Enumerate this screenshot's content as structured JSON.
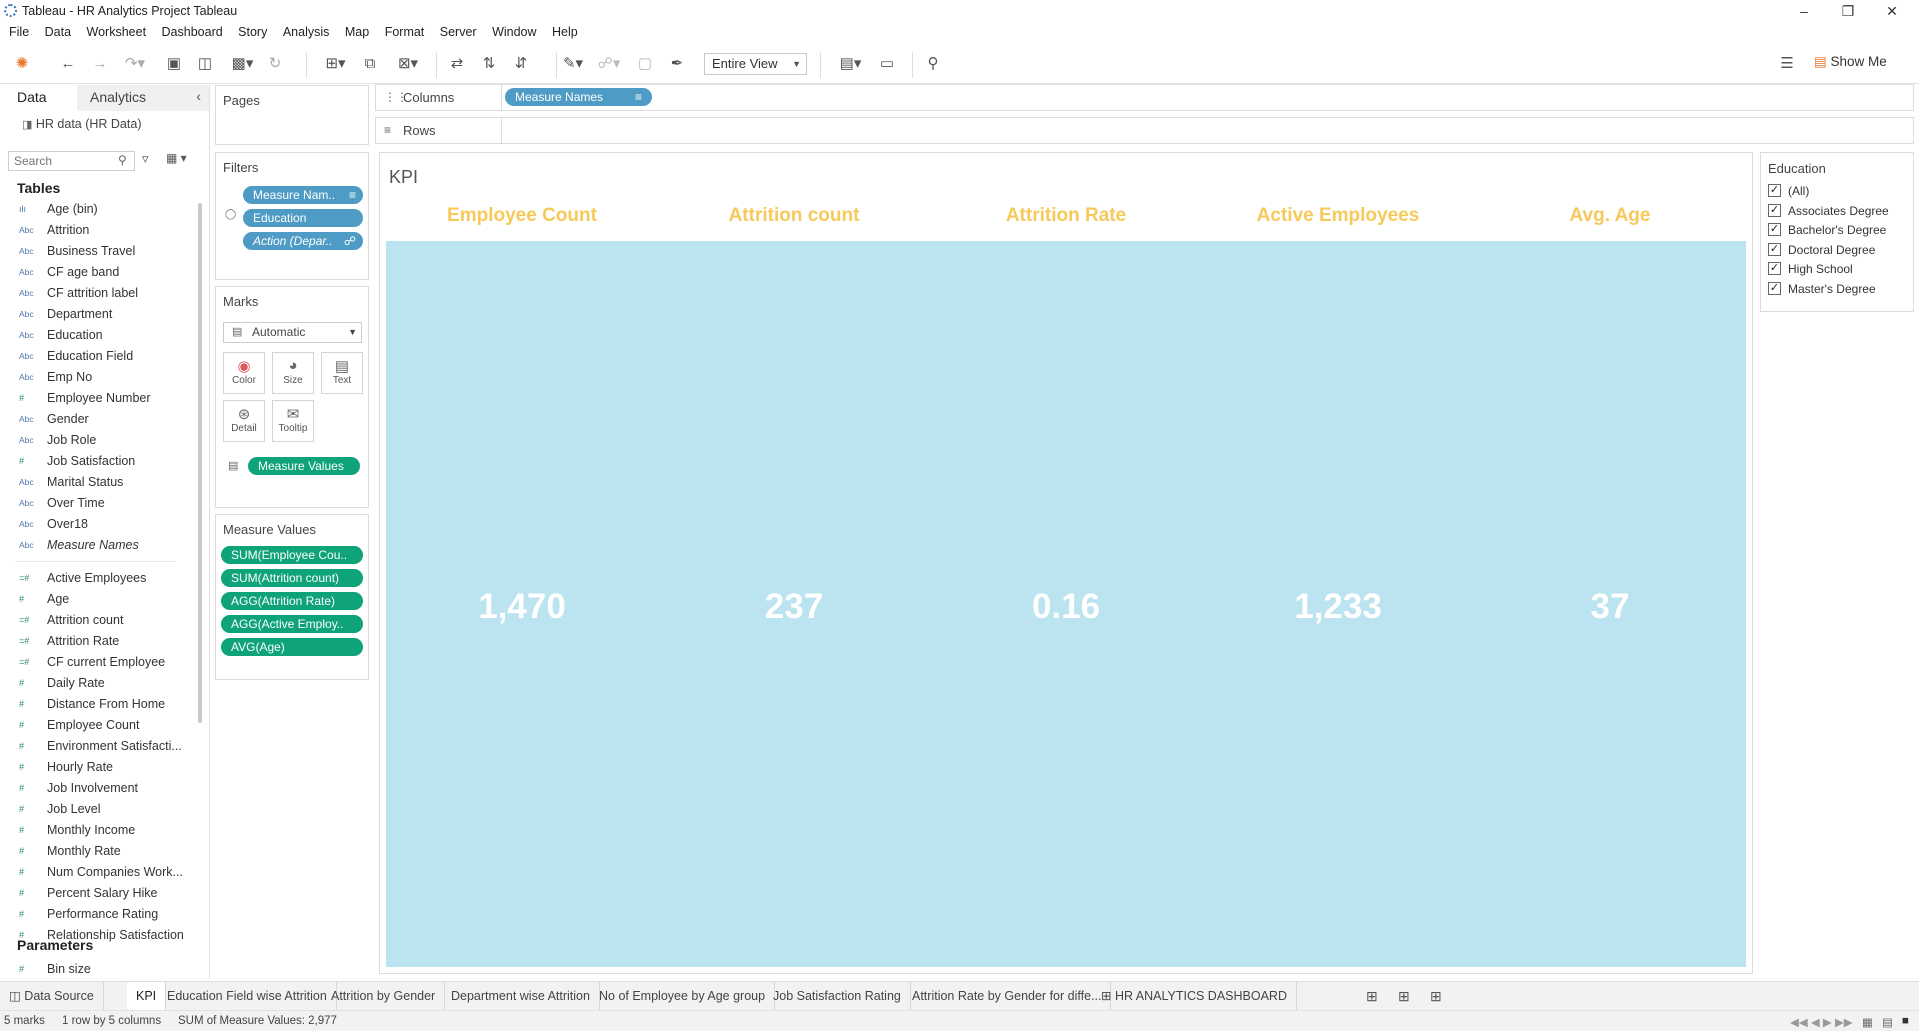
{
  "window": {
    "title": "Tableau - HR Analytics Project Tableau"
  },
  "menu": [
    "File",
    "Data",
    "Worksheet",
    "Dashboard",
    "Story",
    "Analysis",
    "Map",
    "Format",
    "Server",
    "Window",
    "Help"
  ],
  "toolbar": {
    "fit": "Entire View",
    "show_me": "Show Me"
  },
  "data_pane": {
    "tab_data": "Data",
    "tab_analytics": "Analytics",
    "datasource": "HR data (HR Data)",
    "search_placeholder": "Search",
    "tables_heading": "Tables",
    "dimensions": [
      {
        "label": "Age (bin)",
        "icon": "bin-icon"
      },
      {
        "label": "Attrition",
        "icon": "abc-icon"
      },
      {
        "label": "Business Travel",
        "icon": "abc-icon"
      },
      {
        "label": "CF age band",
        "icon": "abc-icon"
      },
      {
        "label": "CF attrition label",
        "icon": "abc-icon"
      },
      {
        "label": "Department",
        "icon": "abc-icon"
      },
      {
        "label": "Education",
        "icon": "abc-icon"
      },
      {
        "label": "Education Field",
        "icon": "abc-icon"
      },
      {
        "label": "Emp No",
        "icon": "abc-icon"
      },
      {
        "label": "Employee Number",
        "icon": "number-icon"
      },
      {
        "label": "Gender",
        "icon": "abc-icon"
      },
      {
        "label": "Job Role",
        "icon": "abc-icon"
      },
      {
        "label": "Job Satisfaction",
        "icon": "number-icon"
      },
      {
        "label": "Marital Status",
        "icon": "abc-icon"
      },
      {
        "label": "Over Time",
        "icon": "abc-icon"
      },
      {
        "label": "Over18",
        "icon": "abc-icon"
      },
      {
        "label": "Measure Names",
        "icon": "abc-icon"
      }
    ],
    "measures": [
      {
        "label": "Active Employees",
        "icon": "calc-number-icon"
      },
      {
        "label": "Age",
        "icon": "number-icon"
      },
      {
        "label": "Attrition count",
        "icon": "calc-number-icon"
      },
      {
        "label": "Attrition Rate",
        "icon": "calc-number-icon"
      },
      {
        "label": "CF current Employee",
        "icon": "calc-number-icon"
      },
      {
        "label": "Daily Rate",
        "icon": "number-icon"
      },
      {
        "label": "Distance From Home",
        "icon": "number-icon"
      },
      {
        "label": "Employee Count",
        "icon": "number-icon"
      },
      {
        "label": "Environment Satisfacti...",
        "icon": "number-icon"
      },
      {
        "label": "Hourly Rate",
        "icon": "number-icon"
      },
      {
        "label": "Job Involvement",
        "icon": "number-icon"
      },
      {
        "label": "Job Level",
        "icon": "number-icon"
      },
      {
        "label": "Monthly Income",
        "icon": "number-icon"
      },
      {
        "label": "Monthly Rate",
        "icon": "number-icon"
      },
      {
        "label": "Num Companies Work...",
        "icon": "number-icon"
      },
      {
        "label": "Percent Salary Hike",
        "icon": "number-icon"
      },
      {
        "label": "Performance Rating",
        "icon": "number-icon"
      },
      {
        "label": "Relationship Satisfaction",
        "icon": "number-icon"
      }
    ],
    "parameters_heading": "Parameters",
    "parameters": [
      {
        "label": "Bin size",
        "icon": "number-icon"
      }
    ]
  },
  "pages_card": {
    "title": "Pages"
  },
  "filters_card": {
    "title": "Filters",
    "pills": [
      "Measure Nam..",
      "Education",
      "Action (Depar.."
    ]
  },
  "marks_card": {
    "title": "Marks",
    "type": "Automatic",
    "buttons": [
      "Color",
      "Size",
      "Text",
      "Detail",
      "Tooltip"
    ],
    "text_pill": "Measure Values"
  },
  "measure_values_card": {
    "title": "Measure Values",
    "pills": [
      "SUM(Employee Cou..",
      "SUM(Attrition count)",
      "AGG(Attrition Rate)",
      "AGG(Active Employ..",
      "AVG(Age)"
    ]
  },
  "shelves": {
    "columns_label": "Columns",
    "columns_pill": "Measure Names",
    "rows_label": "Rows"
  },
  "viz": {
    "title": "KPI",
    "header_color": "#f7c95a",
    "panel_color": "#bce3f0",
    "kpis": [
      {
        "label": "Employee Count",
        "value": "1,470"
      },
      {
        "label": "Attrition count",
        "value": "237"
      },
      {
        "label": "Attrition Rate",
        "value": "0.16"
      },
      {
        "label": "Active Employees",
        "value": "1,233"
      },
      {
        "label": "Avg. Age",
        "value": "37"
      }
    ]
  },
  "legend": {
    "title": "Education",
    "items": [
      {
        "label": "(All)",
        "checked": true
      },
      {
        "label": "Associates Degree",
        "checked": true
      },
      {
        "label": "Bachelor's Degree",
        "checked": true
      },
      {
        "label": "Doctoral Degree",
        "checked": true
      },
      {
        "label": "High School",
        "checked": true
      },
      {
        "label": "Master's Degree",
        "checked": true
      }
    ]
  },
  "sheet_tabs": {
    "data_source": "Data Source",
    "tabs": [
      "KPI",
      "Education Field wise Attrition",
      "Attrition by Gender",
      "Department wise Attrition",
      "No of Employee by Age group",
      "Job Satisfaction Rating",
      "Attrition Rate by Gender for diffe...",
      "HR ANALYTICS DASHBOARD"
    ],
    "active": "KPI"
  },
  "status": {
    "marks": "5 marks",
    "shape": "1 row by 5 columns",
    "sum": "SUM of Measure Values: 2,977"
  }
}
